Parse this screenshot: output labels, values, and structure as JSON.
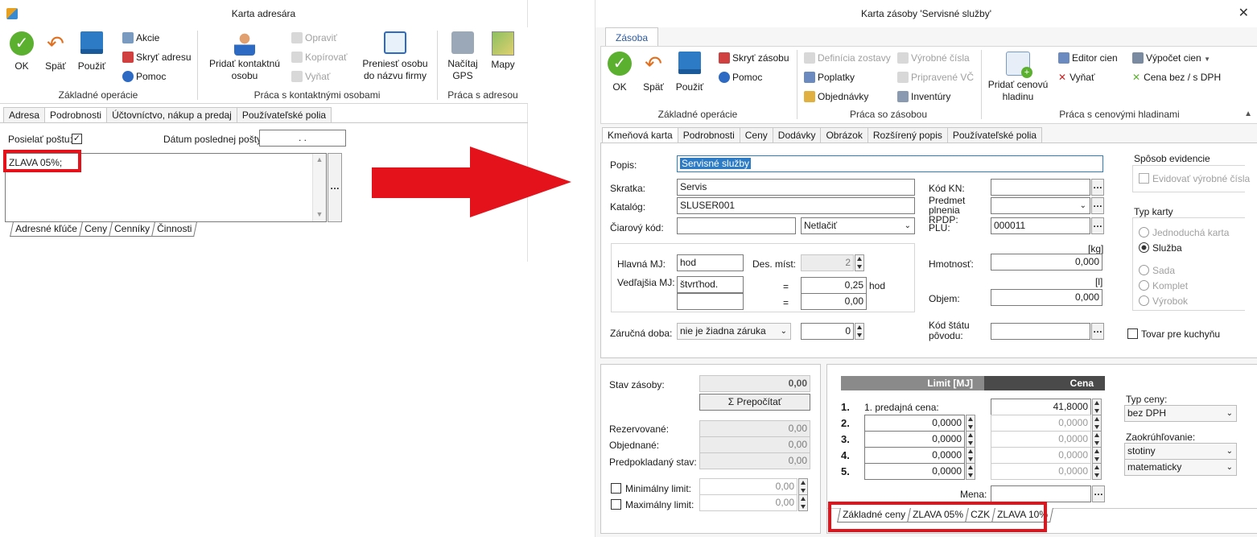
{
  "left": {
    "title": "Karta adresára",
    "ribbon": {
      "ok": "OK",
      "back": "Späť",
      "use": "Použiť",
      "actions": "Akcie",
      "hide_address": "Skryť adresu",
      "help": "Pomoc",
      "add_contact": "Pridať kontaktnú osobu",
      "edit": "Opraviť",
      "copy": "Kopírovať",
      "remove": "Vyňať",
      "move_person": "Preniesť osobu do názvu firmy",
      "load_gps": "Načítaj GPS",
      "maps": "Mapy",
      "group_basic": "Základné operácie",
      "group_contacts": "Práca s kontaktnými osobami",
      "group_address": "Práca s adresou"
    },
    "tabs": [
      "Adresa",
      "Podrobnosti",
      "Účtovníctvo, nákup a predaj",
      "Používateľské polia"
    ],
    "send_mail_label": "Posielať poštu:",
    "last_mail_label": "Dátum poslednej pošty:",
    "last_mail_value": ".   .",
    "note_text": "ZLAVA 05%;",
    "bottom_tabs": [
      "Adresné kľúče",
      "Ceny",
      "Cenníky",
      "Činnosti"
    ]
  },
  "right": {
    "title": "Karta zásoby 'Servisné služby'",
    "ribbon_tab": "Zásoba",
    "ribbon": {
      "ok": "OK",
      "back": "Späť",
      "use": "Použiť",
      "hide_stock": "Skryť zásobu",
      "help": "Pomoc",
      "assembly_def": "Definícia zostavy",
      "fees": "Poplatky",
      "orders": "Objednávky",
      "serials": "Výrobné čísla",
      "prepared_serials": "Pripravené VČ",
      "inventories": "Inventúry",
      "add_price_level": "Pridať cenovú hladinu",
      "price_editor": "Editor cien",
      "remove": "Vyňať",
      "price_calc": "Výpočet cien",
      "price_vat": "Cena bez / s DPH",
      "group_basic": "Základné operácie",
      "group_stock": "Práca so zásobou",
      "group_levels": "Práca s cenovými hladinami"
    },
    "tabs": [
      "Kmeňová karta",
      "Podrobnosti",
      "Ceny",
      "Dodávky",
      "Obrázok",
      "Rozšírený popis",
      "Používateľské polia"
    ],
    "popis_label": "Popis:",
    "popis_value": "Servisné služby",
    "skratka_label": "Skratka:",
    "skratka_value": "Servis",
    "katalog_label": "Katalóg:",
    "katalog_value": "SLUSER001",
    "barcode_label": "Čiarový kód:",
    "barcode_print": "Netlačiť",
    "main_unit_label": "Hlavná MJ:",
    "main_unit": "hod",
    "decimals_label": "Des. míst:",
    "decimals": "2",
    "sec_unit_label": "Vedľajšia MJ:",
    "sec_unit": "štvrťhod.",
    "sec_ratio": "0,25",
    "sec_ratio_unit": "hod",
    "eq": "=",
    "sec_ratio2": "0,00",
    "warranty_label": "Záručná doba:",
    "warranty": "nie je žiadna záruka",
    "warranty_num": "0",
    "kn_label": "Kód KN:",
    "subject_label": "Predmet plnenia RPDP:",
    "plu_label": "PLU:",
    "plu_value": "000011",
    "kg_unit": "[kg]",
    "weight_label": "Hmotnosť:",
    "weight": "0,000",
    "l_unit": "[l]",
    "volume_label": "Objem:",
    "volume": "0,000",
    "origin_label": "Kód štátu pôvodu:",
    "evidence_title": "Spôsob evidencie",
    "evidence_serial": "Evidovať výrobné čísla",
    "card_type_title": "Typ karty",
    "card_types": [
      "Jednoduchá karta",
      "Služba",
      "Sada",
      "Komplet",
      "Výrobok"
    ],
    "kitchen": "Tovar pre kuchyňu",
    "stock_label": "Stav zásoby:",
    "stock_value": "0,00",
    "recalc": "Σ Prepočítať",
    "reserved_label": "Rezervované:",
    "reserved": "0,00",
    "ordered_label": "Objednané:",
    "ordered": "0,00",
    "expected_label": "Predpokladaný stav:",
    "expected": "0,00",
    "min_label": "Minimálny limit:",
    "min": "0,00",
    "max_label": "Maximálny limit:",
    "max": "0,00",
    "limit_header": "Limit [MJ]",
    "price_header": "Cena",
    "price_rows": [
      {
        "n": "1.",
        "label": "1. predajná cena:",
        "limit": "",
        "price": "41,8000"
      },
      {
        "n": "2.",
        "label": "",
        "limit": "0,0000",
        "price": "0,0000"
      },
      {
        "n": "3.",
        "label": "",
        "limit": "0,0000",
        "price": "0,0000"
      },
      {
        "n": "4.",
        "label": "",
        "limit": "0,0000",
        "price": "0,0000"
      },
      {
        "n": "5.",
        "label": "",
        "limit": "0,0000",
        "price": "0,0000"
      }
    ],
    "currency_label": "Mena:",
    "price_type_label": "Typ ceny:",
    "price_type": "bez DPH",
    "rounding_label": "Zaokrúhľovanie:",
    "rounding1": "stotiny",
    "rounding2": "matematicky",
    "bottom_tabs": [
      "Základné ceny",
      "ZLAVA 05%",
      "CZK",
      "ZLAVA 10%"
    ]
  }
}
